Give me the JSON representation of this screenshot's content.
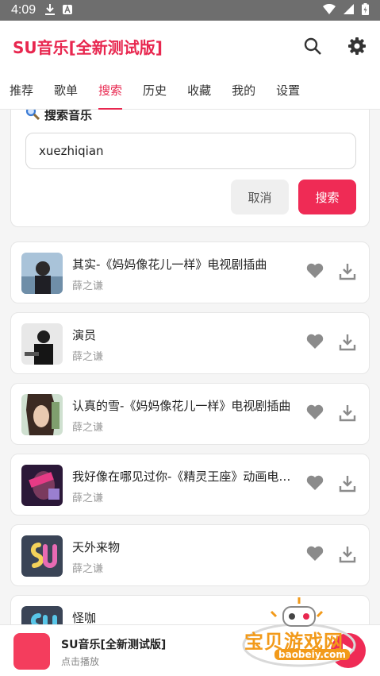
{
  "status_bar": {
    "time": "4:09"
  },
  "app": {
    "title": "SU音乐[全新测试版]"
  },
  "tabs": [
    {
      "label": "推荐"
    },
    {
      "label": "歌单"
    },
    {
      "label": "搜索"
    },
    {
      "label": "历史"
    },
    {
      "label": "收藏"
    },
    {
      "label": "我的"
    },
    {
      "label": "设置"
    }
  ],
  "search": {
    "title": "搜索音乐",
    "input_value": "xuezhiqian",
    "cancel_label": "取消",
    "search_label": "搜索"
  },
  "songs": [
    {
      "name": "其实-《妈妈像花儿一样》电视剧插曲",
      "artist": "薛之谦"
    },
    {
      "name": "演员",
      "artist": "薛之谦"
    },
    {
      "name": "认真的雪-《妈妈像花儿一样》电视剧插曲",
      "artist": "薛之谦"
    },
    {
      "name": "我好像在哪见过你-《精灵王座》动画电影主题曲",
      "artist": "薛之谦"
    },
    {
      "name": "天外来物",
      "artist": "薛之谦"
    },
    {
      "name": "怪咖",
      "artist": ""
    }
  ],
  "player": {
    "title": "SU音乐[全新测试版]",
    "subtitle": "点击播放"
  },
  "watermark": {
    "text": "宝贝游戏网",
    "url": "baobeiy.com"
  },
  "colors": {
    "accent": "#e8274f",
    "button_red": "#ef2b55"
  }
}
